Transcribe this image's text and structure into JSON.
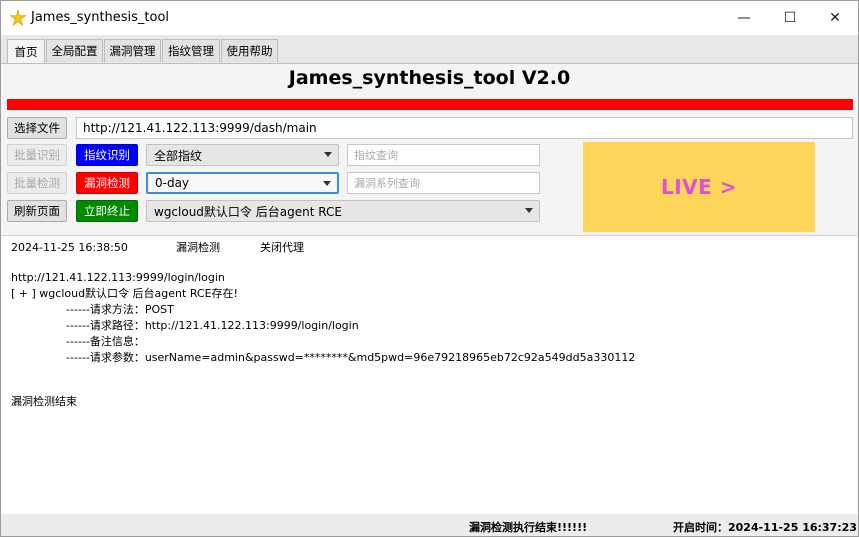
{
  "window": {
    "title": "James_synthesis_tool",
    "minimize": "—",
    "maximize": "☐",
    "close": "✕"
  },
  "tabs": [
    {
      "label": "首页",
      "active": true
    },
    {
      "label": "全局配置",
      "active": false
    },
    {
      "label": "漏洞管理",
      "active": false
    },
    {
      "label": "指纹管理",
      "active": false
    },
    {
      "label": "使用帮助",
      "active": false
    }
  ],
  "header": {
    "app_title": "James_synthesis_tool V2.0",
    "accent_color": "#ff0000"
  },
  "controls": {
    "select_file_button": "选择文件",
    "url_value": "http://121.41.122.113:9999/dash/main",
    "batch_identify_button": "批量识别",
    "fingerprint_identify_button": "指纹识别",
    "fingerprint_select": "全部指纹",
    "fingerprint_query_placeholder": "指纹查询",
    "batch_detect_button": "批量检测",
    "vuln_detect_button": "漏洞检测",
    "vuln_type_select": "0-day",
    "vuln_series_placeholder": "漏洞系列查询",
    "refresh_button": "刷新页面",
    "stop_button": "立即终止",
    "poc_select": "wgcloud默认口令 后台agent RCE"
  },
  "live_banner": {
    "text": "LIVE >",
    "bg_color": "#fcd559",
    "text_color": "#e14fd8"
  },
  "output": {
    "timestamp": "2024-11-25 16:38:50",
    "mode": "漏洞检测",
    "proxy": "关闭代理",
    "target_url": "http://121.41.122.113:9999/login/login",
    "result": "[ + ] wgcloud默认口令 后台agent RCE存在!",
    "method_line": "------请求方法：POST",
    "path_line": "------请求路径：http://121.41.122.113:9999/login/login",
    "note_line": "------备注信息：",
    "params_line": "------请求参数：userName=admin&passwd=********&md5pwd=96e79218965eb72c92a549dd5a330112",
    "end_line": "漏洞检测结束"
  },
  "status": {
    "message": "漏洞检测执行结束!!!!!!",
    "start_time": "开启时间：2024-11-25 16:37:23"
  }
}
